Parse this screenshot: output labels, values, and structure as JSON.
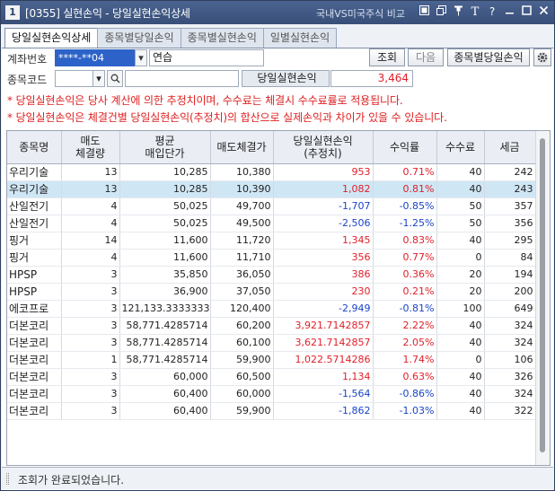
{
  "window": {
    "number": "1",
    "title": "[0355] 실현손익 - 당일실현손익상세",
    "link": "국내VS미국주식 비교",
    "icons": [
      "restore-icon",
      "copy-icon",
      "pin-icon",
      "text-icon",
      "help-icon",
      "minimize-icon",
      "maximize-icon",
      "close-icon"
    ]
  },
  "tabs": [
    "당일실현손익상세",
    "종목별당일손익",
    "종목별실현손익",
    "일별실현손익"
  ],
  "form": {
    "account_label": "계좌번호",
    "account_value": "****-**04",
    "account_name": "연습",
    "stock_label": "종목코드",
    "stock_value": "",
    "stock_name": "",
    "query_button": "조회",
    "next_button": "다음",
    "per_stock_button": "종목별당일손익",
    "pnl_label": "당일실현손익",
    "pnl_value": "3,464"
  },
  "notes": [
    "* 당일실현손익은 당사 계산에 의한 추정치이며, 수수료는 체결시 수수료률로 적용됩니다.",
    "* 당일실현손익은 체결건별 당일실현손익(추정치)의 합산으로 실제손익과 차이가 있을 수 있습니다."
  ],
  "table": {
    "headers": [
      [
        "종목명"
      ],
      [
        "매도",
        "체결량"
      ],
      [
        "평균",
        "매입단가"
      ],
      [
        "매도체결가"
      ],
      [
        "당일실현손익",
        "(추정치)"
      ],
      [
        "수익률"
      ],
      [
        "수수료"
      ],
      [
        "세금"
      ]
    ],
    "rows": [
      {
        "name": "우리기술",
        "qty": "13",
        "avg": "10,285",
        "sell": "10,380",
        "pnl": "953",
        "rate": "0.71%",
        "fee": "40",
        "tax": "242",
        "sign": "pos"
      },
      {
        "name": "우리기술",
        "qty": "13",
        "avg": "10,285",
        "sell": "10,390",
        "pnl": "1,082",
        "rate": "0.81%",
        "fee": "40",
        "tax": "243",
        "sign": "pos",
        "selected": true
      },
      {
        "name": "산일전기",
        "qty": "4",
        "avg": "50,025",
        "sell": "49,700",
        "pnl": "-1,707",
        "rate": "-0.85%",
        "fee": "50",
        "tax": "357",
        "sign": "neg"
      },
      {
        "name": "산일전기",
        "qty": "4",
        "avg": "50,025",
        "sell": "49,500",
        "pnl": "-2,506",
        "rate": "-1.25%",
        "fee": "50",
        "tax": "356",
        "sign": "neg"
      },
      {
        "name": "핑거",
        "qty": "14",
        "avg": "11,600",
        "sell": "11,720",
        "pnl": "1,345",
        "rate": "0.83%",
        "fee": "40",
        "tax": "295",
        "sign": "pos"
      },
      {
        "name": "핑거",
        "qty": "4",
        "avg": "11,600",
        "sell": "11,710",
        "pnl": "356",
        "rate": "0.77%",
        "fee": "0",
        "tax": "84",
        "sign": "pos"
      },
      {
        "name": "HPSP",
        "qty": "3",
        "avg": "35,850",
        "sell": "36,050",
        "pnl": "386",
        "rate": "0.36%",
        "fee": "20",
        "tax": "194",
        "sign": "pos"
      },
      {
        "name": "HPSP",
        "qty": "3",
        "avg": "36,900",
        "sell": "37,050",
        "pnl": "230",
        "rate": "0.21%",
        "fee": "20",
        "tax": "200",
        "sign": "pos"
      },
      {
        "name": "에코프로",
        "qty": "3",
        "avg": "121,133.3333333",
        "sell": "120,400",
        "pnl": "-2,949",
        "rate": "-0.81%",
        "fee": "100",
        "tax": "649",
        "sign": "neg"
      },
      {
        "name": "더본코리",
        "qty": "3",
        "avg": "58,771.4285714",
        "sell": "60,200",
        "pnl": "3,921.7142857",
        "rate": "2.22%",
        "fee": "40",
        "tax": "324",
        "sign": "pos"
      },
      {
        "name": "더본코리",
        "qty": "3",
        "avg": "58,771.4285714",
        "sell": "60,100",
        "pnl": "3,621.7142857",
        "rate": "2.05%",
        "fee": "40",
        "tax": "324",
        "sign": "pos"
      },
      {
        "name": "더본코리",
        "qty": "1",
        "avg": "58,771.4285714",
        "sell": "59,900",
        "pnl": "1,022.5714286",
        "rate": "1.74%",
        "fee": "0",
        "tax": "106",
        "sign": "pos"
      },
      {
        "name": "더본코리",
        "qty": "3",
        "avg": "60,000",
        "sell": "60,500",
        "pnl": "1,134",
        "rate": "0.63%",
        "fee": "40",
        "tax": "326",
        "sign": "pos"
      },
      {
        "name": "더본코리",
        "qty": "3",
        "avg": "60,400",
        "sell": "60,000",
        "pnl": "-1,564",
        "rate": "-0.86%",
        "fee": "40",
        "tax": "324",
        "sign": "neg"
      },
      {
        "name": "더본코리",
        "qty": "3",
        "avg": "60,400",
        "sell": "59,900",
        "pnl": "-1,862",
        "rate": "-1.03%",
        "fee": "40",
        "tax": "322",
        "sign": "neg"
      }
    ]
  },
  "status": "조회가 완료되었습니다."
}
